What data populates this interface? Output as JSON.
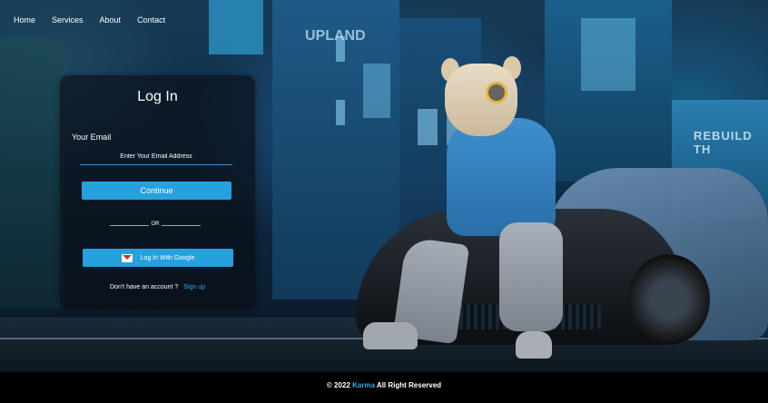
{
  "nav": {
    "items": [
      {
        "label": "Home"
      },
      {
        "label": "Services"
      },
      {
        "label": "About"
      },
      {
        "label": "Contact"
      }
    ]
  },
  "login": {
    "title": "Log In",
    "email_label": "Your Email",
    "email_placeholder": "Enter Your Email Address",
    "email_value": "",
    "continue_label": "Continue",
    "or_text": "OR",
    "google_label": "Log In With Google",
    "no_account_text": "Don't have an account ?",
    "signup_label": "Sign up"
  },
  "footer": {
    "copyright_prefix": "© 2022",
    "brand": "Karma",
    "suffix": "All Right Reserved"
  },
  "background": {
    "sign_text": "REBUILD TH",
    "vertical_sign": "UPLAND"
  },
  "colors": {
    "accent": "#27a0de",
    "link": "#2fa7e8",
    "panel": "rgba(10,12,16,0.62)",
    "footer": "#000000"
  },
  "icons": {
    "google": "gmail-envelope-icon"
  }
}
